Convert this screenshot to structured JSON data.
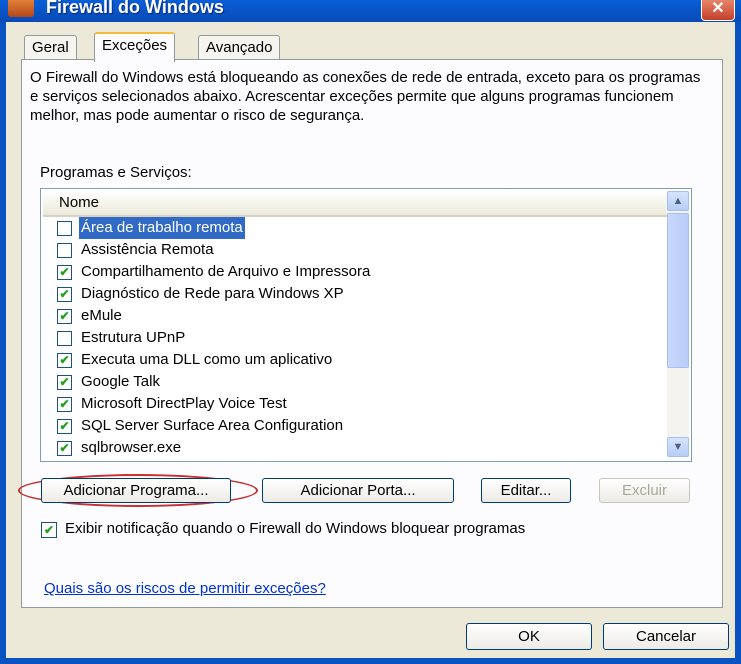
{
  "window": {
    "title": "Firewall do Windows",
    "close_glyph": "✕",
    "icon": "firewall-icon"
  },
  "tabs": [
    {
      "label": "Geral"
    },
    {
      "label": "Exceções",
      "active": true
    },
    {
      "label": "Avançado"
    }
  ],
  "description": "O Firewall do Windows está bloqueando as conexões de rede de entrada, exceto para os programas e serviços selecionados abaixo. Acrescentar exceções permite que alguns programas funcionem melhor, mas pode aumentar o risco de segurança.",
  "programs_group_label": "Programas e Serviços:",
  "list": {
    "column_header": "Nome",
    "items": [
      {
        "label": "Área de trabalho remota",
        "checked": false,
        "selected": true
      },
      {
        "label": "Assistência Remota",
        "checked": false
      },
      {
        "label": "Compartilhamento de Arquivo e Impressora",
        "checked": true
      },
      {
        "label": "Diagnóstico de Rede para Windows XP",
        "checked": true
      },
      {
        "label": "eMule",
        "checked": true
      },
      {
        "label": "Estrutura UPnP",
        "checked": false
      },
      {
        "label": "Executa uma DLL como um aplicativo",
        "checked": true
      },
      {
        "label": "Google Talk",
        "checked": true
      },
      {
        "label": "Microsoft DirectPlay Voice Test",
        "checked": true
      },
      {
        "label": "SQL Server Surface Area Configuration",
        "checked": true
      },
      {
        "label": "sqlbrowser.exe",
        "checked": true
      }
    ]
  },
  "buttons": {
    "add_program": "Adicionar Programa...",
    "add_port": "Adicionar Porta...",
    "edit": "Editar...",
    "delete": "Excluir",
    "ok": "OK",
    "cancel": "Cancelar"
  },
  "notify_checkbox": {
    "label": "Exibir notificação quando o Firewall do Windows bloquear programas",
    "checked": true
  },
  "risk_link": "Quais são os riscos de permitir exceções?",
  "colors": {
    "accent": "#0852C2",
    "selection": "#316AC5",
    "highlight_ring": "#C53030"
  }
}
